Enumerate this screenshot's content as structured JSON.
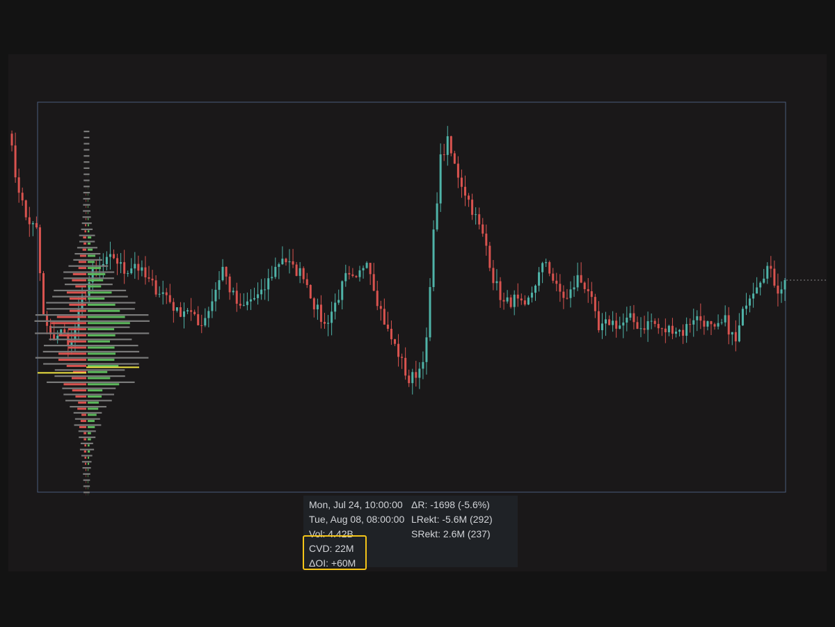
{
  "chart_data": {
    "type": "candlestick",
    "title": "",
    "colors": {
      "up": "#4fb3a8",
      "down": "#d9534f",
      "profile_buy": "#5cb85c",
      "profile_sell": "#d9534f",
      "profile_total": "#7a7a7a",
      "poc_line": "#f0e442",
      "range_box": "#4a5d7a",
      "highlight": "#f5c518"
    },
    "price_path": [
      [
        0,
        1.0
      ],
      [
        2,
        0.78
      ],
      [
        5,
        0.58
      ],
      [
        8,
        0.52
      ],
      [
        10,
        0.12
      ],
      [
        12,
        0.02
      ],
      [
        15,
        0.05
      ],
      [
        18,
        0.0
      ],
      [
        21,
        0.2
      ],
      [
        24,
        0.32
      ],
      [
        27,
        0.36
      ],
      [
        30,
        0.4
      ],
      [
        33,
        0.33
      ],
      [
        36,
        0.37
      ],
      [
        39,
        0.3
      ],
      [
        42,
        0.25
      ],
      [
        45,
        0.22
      ],
      [
        48,
        0.14
      ],
      [
        51,
        0.16
      ],
      [
        54,
        0.08
      ],
      [
        56,
        0.12
      ],
      [
        58,
        0.2
      ],
      [
        61,
        0.35
      ],
      [
        63,
        0.25
      ],
      [
        66,
        0.15
      ],
      [
        69,
        0.2
      ],
      [
        72,
        0.22
      ],
      [
        75,
        0.32
      ],
      [
        78,
        0.4
      ],
      [
        81,
        0.34
      ],
      [
        84,
        0.32
      ],
      [
        87,
        0.18
      ],
      [
        90,
        0.08
      ],
      [
        93,
        0.18
      ],
      [
        96,
        0.3
      ],
      [
        99,
        0.28
      ],
      [
        102,
        0.4
      ],
      [
        105,
        0.2
      ],
      [
        108,
        0.05
      ],
      [
        111,
        -0.05
      ],
      [
        114,
        -0.18
      ],
      [
        117,
        -0.12
      ],
      [
        119,
        0.0
      ],
      [
        121,
        0.5
      ],
      [
        123,
        0.85
      ],
      [
        125,
        0.93
      ],
      [
        127,
        0.82
      ],
      [
        130,
        0.7
      ],
      [
        133,
        0.58
      ],
      [
        136,
        0.45
      ],
      [
        138,
        0.3
      ],
      [
        141,
        0.18
      ],
      [
        144,
        0.2
      ],
      [
        147,
        0.15
      ],
      [
        150,
        0.28
      ],
      [
        153,
        0.38
      ],
      [
        156,
        0.25
      ],
      [
        159,
        0.2
      ],
      [
        162,
        0.3
      ],
      [
        165,
        0.25
      ],
      [
        168,
        0.05
      ],
      [
        171,
        0.1
      ],
      [
        174,
        0.08
      ],
      [
        177,
        0.11
      ],
      [
        180,
        0.07
      ],
      [
        183,
        0.1
      ],
      [
        186,
        0.05
      ],
      [
        189,
        0.07
      ],
      [
        192,
        0.05
      ],
      [
        195,
        0.12
      ],
      [
        198,
        0.1
      ],
      [
        201,
        0.05
      ],
      [
        204,
        0.1
      ],
      [
        207,
        0.0
      ],
      [
        210,
        0.2
      ],
      [
        213,
        0.28
      ],
      [
        216,
        0.35
      ],
      [
        219,
        0.25
      ],
      [
        221,
        0.28
      ]
    ],
    "volume_profile": {
      "levels": 60,
      "peak_level": 48,
      "poc_level": 38
    },
    "value_area_range": {
      "start": "Mon, Jul 24, 10:00:00",
      "end": "Tue, Aug 08, 08:00:00"
    }
  },
  "info": {
    "start_label": "Mon, Jul 24, 10:00:00",
    "end_label": "Tue, Aug 08, 08:00:00",
    "delta_range": "ΔR: -1698 (-5.6%)",
    "lrekt": "LRekt: -5.6M (292)",
    "vol": "Vol: 4.42B",
    "srekt": "SRekt: 2.6M (237)",
    "cvd": "CVD: 22M",
    "doi": "ΔOI: +60M"
  }
}
